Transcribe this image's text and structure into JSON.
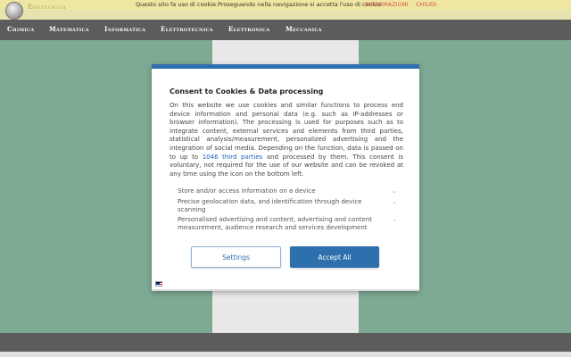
{
  "cookie_banner": {
    "message": "Questo sito fa uso di cookie.Proseguendo nella navigazione si accetta l'uso di cookie.",
    "info_link": "INFORMAZIONI",
    "close_link": "CHIUDI"
  },
  "site": {
    "logo_text": "Edutecnica"
  },
  "nav": {
    "items": [
      "Chimica",
      "Matematica",
      "Informatica",
      "Elettrotecnica",
      "Elettronica",
      "Meccanica"
    ]
  },
  "consent_dialog": {
    "title": "Consent to Cookies & Data processing",
    "body_before_link": "On this website we use cookies and similar functions to process end device information and personal data (e.g. such as IP-addresses or browser information). The processing is used for purposes such as to integrate content, external services and elements from third parties, statistical analysis/measurement, personalized advertising and the integration of social media. Depending on the function, data is passed on to up to ",
    "third_parties_link": "1046 third parties",
    "body_after_link": " and processed by them. This consent is voluntary, not required for the use of our website and can be revoked at any time using the icon on the bottom left.",
    "purposes": [
      "Store and/or access information on a device",
      "Precise geolocation data, and identification through device scanning",
      "Personalised advertising and content, advertising and content measurement, audience research and services development"
    ],
    "settings_label": "Settings",
    "accept_label": "Accept All"
  },
  "colors": {
    "accent": "#2e6fad",
    "background": "#7eaa94",
    "nav_bar": "#5c5c5c",
    "cookie_bar": "#efe6a1"
  },
  "icons": {
    "logo": "globe-logo-icon",
    "chevron": "chevron-down-icon",
    "language": "uk-flag-icon"
  }
}
